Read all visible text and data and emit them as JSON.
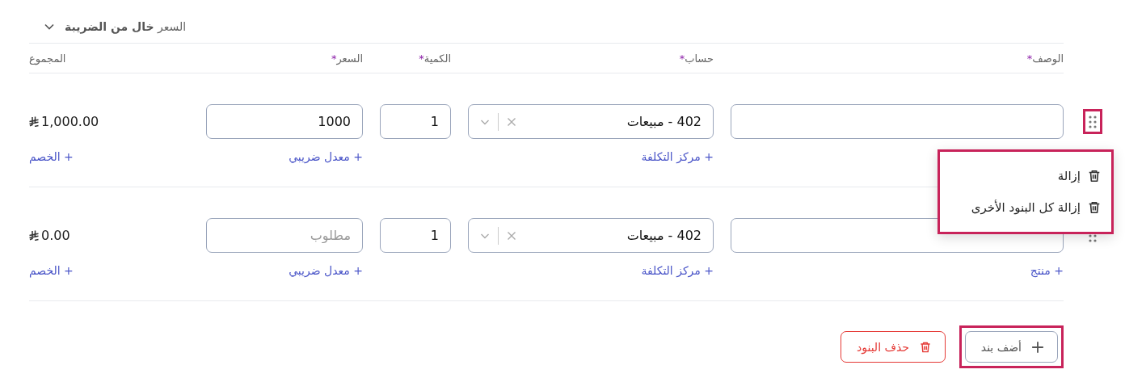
{
  "section": {
    "title": "السعر **خال من الضريبة**",
    "expanded": true
  },
  "columns": [
    {
      "label": "الوصف",
      "mark": "*"
    },
    {
      "label": "حساب",
      "mark": "*"
    },
    {
      "label": "الكمية",
      "mark": "*"
    },
    {
      "label": "السعر",
      "mark": "*"
    },
    {
      "label": "المجموع"
    }
  ],
  "rows": [
    {
      "handle_highlighted": true,
      "account": "402 - مبيعات",
      "account_link": "+ مركز التكلفة",
      "quantity": "1",
      "price": "1000",
      "price_link": "+ معدل ضريبي",
      "total": "1,000.00",
      "total_link": "+ الخصم"
    },
    {
      "handle_highlighted": false,
      "description_link": "+ منتج",
      "account": "402 - مبيعات",
      "account_link": "+ مركز التكلفة",
      "quantity": "1",
      "price_placeholder": "مطلوب",
      "price_link": "+ معدل ضريبي",
      "total": "0.00",
      "total_link": "+ الخصم"
    }
  ],
  "menu": {
    "highlighted": true,
    "items": [
      {
        "label": "إزالة"
      },
      {
        "label": "إزالة كل البنود الأخرى"
      }
    ]
  },
  "buttons": [
    {
      "kind": "add",
      "label": "أضف بند",
      "highlighted": true
    },
    {
      "kind": "delete",
      "label": "حذف البنود",
      "highlighted": false
    }
  ]
}
